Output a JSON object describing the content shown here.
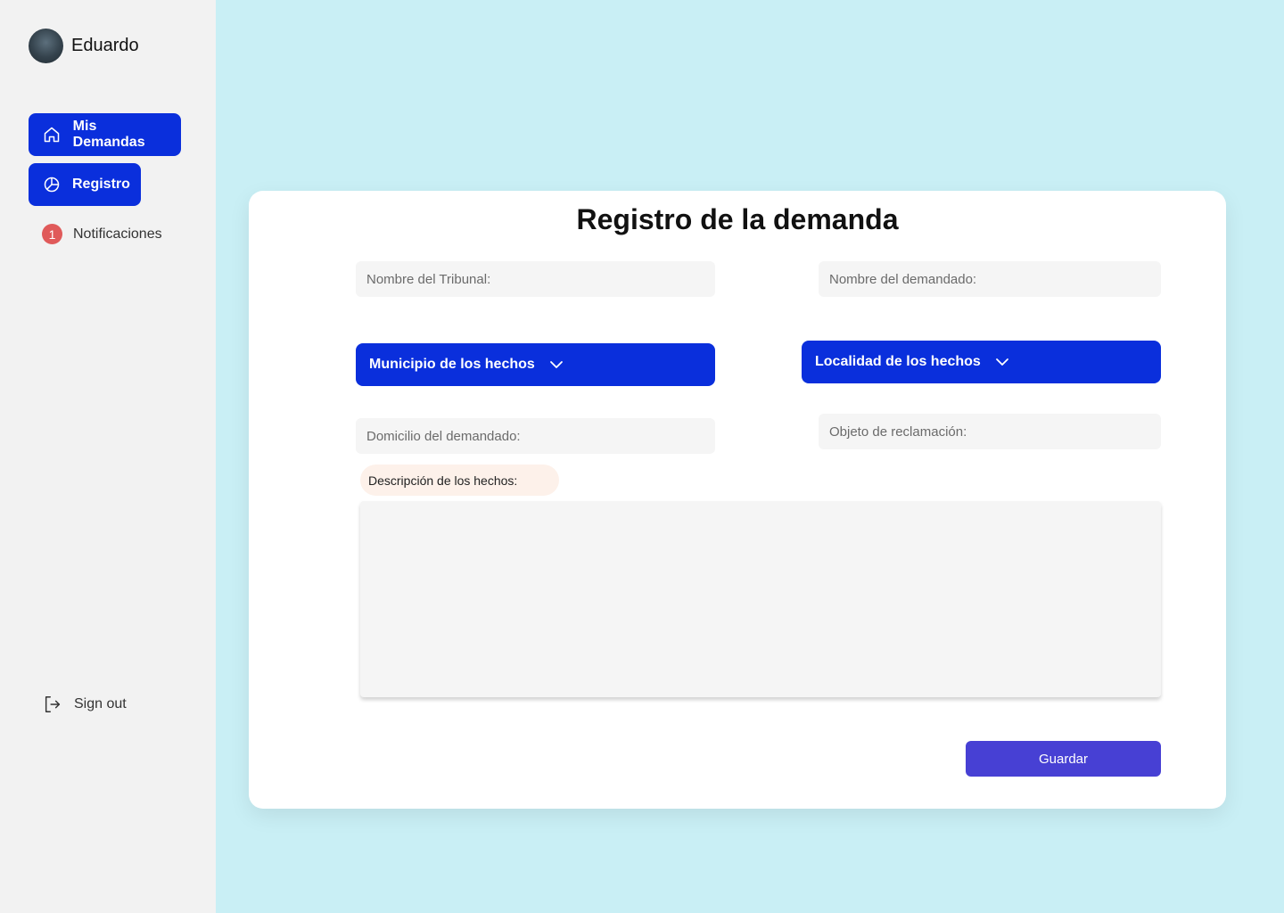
{
  "sidebar": {
    "user_name": "Eduardo",
    "nav": {
      "mis_demandas": "Mis Demandas",
      "registro": "Registro",
      "notificaciones": "Notificaciones",
      "notif_count": "1"
    },
    "sign_out": "Sign out"
  },
  "form": {
    "title": "Registro de la demanda",
    "nombre_tribunal_placeholder": "Nombre del Tribunal:",
    "nombre_demandado_placeholder": "Nombre del demandado:",
    "municipio_label": "Municipio de los hechos",
    "localidad_label": "Localidad de los hechos",
    "domicilio_placeholder": "Domicilio del demandado:",
    "objeto_placeholder": "Objeto de reclamación:",
    "descripcion_label": "Descripción de los hechos:",
    "save_label": "Guardar"
  },
  "colors": {
    "accent": "#0a2fdc",
    "save": "#4740d4",
    "background": "#c9eff5",
    "badge": "#e05a5a"
  },
  "icons": {
    "mis_demandas": "home-icon",
    "registro": "pie-chart-icon",
    "sign_out": "sign-out-icon",
    "dropdown": "chevron-down-icon"
  }
}
